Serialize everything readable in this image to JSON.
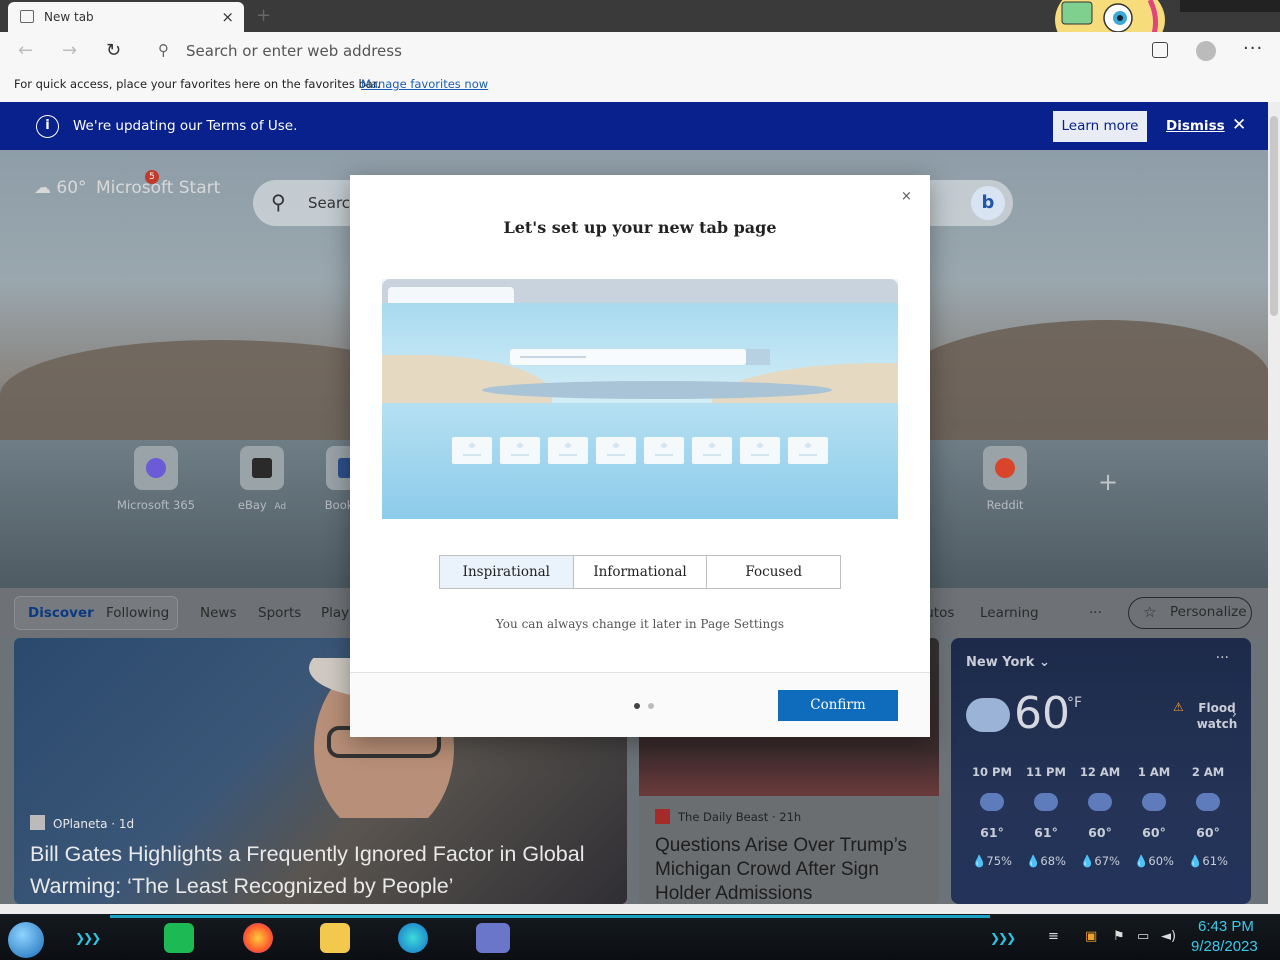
{
  "tab": {
    "title": "New tab",
    "close": "×",
    "new_tab": "+"
  },
  "toolbar": {
    "back": "←",
    "forward": "→",
    "refresh": "↻",
    "address_placeholder": "Search or enter web address",
    "menu": "···"
  },
  "favbar": {
    "message": "For quick access, place your favorites here on the favorites bar.",
    "link": "Manage favorites now"
  },
  "notice": {
    "text": "We're updating our Terms of Use.",
    "learn_more": "Learn more",
    "dismiss": "Dismiss",
    "close": "✕"
  },
  "hero": {
    "weather_temp": "60°",
    "brand": "Microsoft Start",
    "notification_count": "5",
    "search_placeholder": "Search",
    "bing": "b",
    "quick_links": [
      {
        "label": "Microsoft 365",
        "color": "#6b5bd6"
      },
      {
        "label": "eBay",
        "ad": "Ad",
        "color": "#2a2a2a"
      },
      {
        "label": "Booking",
        "color": "#2d4f8a"
      },
      {
        "label": "Reddit",
        "color": "#d9452b"
      }
    ],
    "add": "+"
  },
  "feed_nav": {
    "items": [
      "Discover",
      "Following",
      "News",
      "Sports",
      "Play",
      "Autos",
      "Learning"
    ],
    "more": "···",
    "personalize": "Personalize"
  },
  "card1": {
    "source": "OPlaneta · 1d",
    "headline": "Bill Gates Highlights a Frequently Ignored Factor in Global Warming: ‘The Least Recognized by People’"
  },
  "card2": {
    "source": "The Daily Beast · 21h",
    "headline": "Questions Arise Over Trump’s Michigan Crowd After Sign Holder Admissions"
  },
  "weather": {
    "location": "New York",
    "more": "···",
    "temp": "60",
    "unit": "°F",
    "alert": "Flood watch",
    "hours": [
      {
        "time": "10 PM",
        "temp": "61°",
        "precip": "75%"
      },
      {
        "time": "11 PM",
        "temp": "61°",
        "precip": "68%"
      },
      {
        "time": "12 AM",
        "temp": "60°",
        "precip": "67%"
      },
      {
        "time": "1 AM",
        "temp": "60°",
        "precip": "60%"
      },
      {
        "time": "2 AM",
        "temp": "60°",
        "precip": "61%"
      }
    ]
  },
  "modal": {
    "close": "×",
    "title": "Let's set up your new tab page",
    "options": [
      "Inspirational",
      "Informational",
      "Focused"
    ],
    "selected": "Inspirational",
    "hint": "You can always change it later in Page Settings",
    "confirm": "Confirm",
    "page": 1,
    "pages": 2
  },
  "taskbar": {
    "time": "6:43 PM",
    "date": "9/28/2023"
  }
}
